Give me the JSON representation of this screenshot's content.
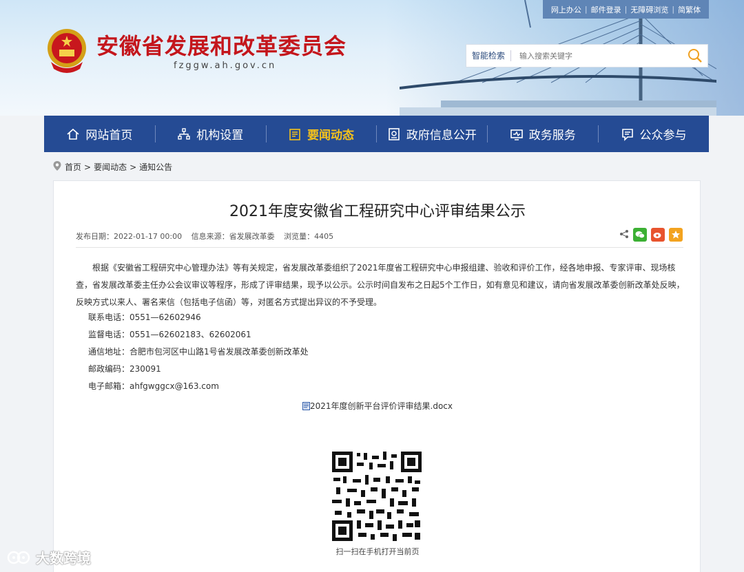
{
  "header": {
    "site_title": "安徽省发展和改革委员会",
    "site_domain": "fzggw.ah.gov.cn",
    "top_links": [
      "网上办公",
      "邮件登录",
      "无障碍浏览",
      "简繁体"
    ],
    "search": {
      "label": "智能检索",
      "placeholder": "输入搜索关键字"
    }
  },
  "nav": {
    "items": [
      {
        "label": "网站首页",
        "icon": "home-icon"
      },
      {
        "label": "机构设置",
        "icon": "org-icon"
      },
      {
        "label": "要闻动态",
        "icon": "news-icon"
      },
      {
        "label": "政府信息公开",
        "icon": "info-icon"
      },
      {
        "label": "政务服务",
        "icon": "service-icon"
      },
      {
        "label": "公众参与",
        "icon": "participate-icon"
      }
    ],
    "active_index": 2
  },
  "breadcrumb": {
    "items": [
      "首页",
      "要闻动态",
      "通知公告"
    ],
    "separator": ">"
  },
  "article": {
    "title": "2021年度安徽省工程研究中心评审结果公示",
    "meta": {
      "date": "发布日期：2022-01-17 00:00",
      "source": "信息来源：省发展改革委",
      "views": "浏览量：4405"
    },
    "body": "根据《安徽省工程研究中心管理办法》等有关规定，省发展改革委组织了2021年度省工程研究中心申报组建、验收和评价工作，经各地申报、专家评审、现场核查，省发展改革委主任办公会议审议等程序，形成了评审结果，现予以公示。公示时间自发布之日起5个工作日，如有意见和建议，请向省发展改革委创新改革处反映，反映方式以来人、署名来信（包括电子信函）等，对匿名方式提出异议的不予受理。",
    "contacts": [
      "联系电话：0551—62602946",
      "监督电话：0551—62602183、62602061",
      "通信地址：合肥市包河区中山路1号省发展改革委创新改革处",
      "邮政编码：230091",
      "电子邮箱：ahfgwggcx@163.com"
    ],
    "attachment": "2021年度创新平台评价评审结果.docx",
    "qr_caption": "扫一扫在手机打开当前页"
  },
  "watermark": "大数跨境",
  "colors": {
    "nav_bg": "#254b94",
    "nav_active": "#f6c21b",
    "title_red": "#c4161c",
    "toplinks_bg": "#5f85b6"
  }
}
